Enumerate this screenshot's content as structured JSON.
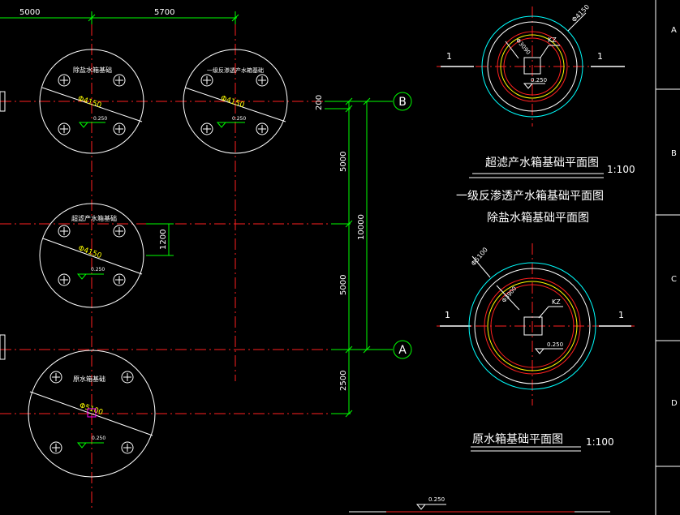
{
  "dims": {
    "top_5000": "5000",
    "top_5700": "5700",
    "v_200": "200",
    "v_5000a": "5000",
    "v_10000": "10000",
    "v_5000b": "5000",
    "v_2500": "2500",
    "v_1200": "1200"
  },
  "axes": {
    "b": "B",
    "a": "A"
  },
  "border": {
    "a": "A",
    "b": "B",
    "c": "C",
    "d": "D"
  },
  "tanks": {
    "t1": {
      "name": "除盐水箱基础",
      "dia": "Φ4150",
      "elev": "0.250"
    },
    "t2": {
      "name": "一级反渗透产水箱基础",
      "dia": "Φ4150",
      "elev": "0.250"
    },
    "t3": {
      "name": "超滤产水箱基础",
      "dia": "Φ4150",
      "elev": "0.250"
    },
    "t4": {
      "name": "原水箱基础",
      "dia": "Φ5100",
      "elev": "0.250"
    }
  },
  "detail_top": {
    "dia_outer": "Φ4150",
    "dia_inner": "Φ3090",
    "kz": "KZ",
    "elev": "0.250",
    "section_l": "1",
    "section_r": "1"
  },
  "detail_bot": {
    "dia_outer": "Φ5100",
    "dia_inner": "Φ3900",
    "kz": "KZ",
    "elev": "0.250",
    "section_l": "1",
    "section_r": "1"
  },
  "titles": {
    "t_uf": "超滤产水箱基础平面图",
    "scale_1": "1:100",
    "t_ro": "一级反渗透产水箱基础平面图",
    "t_demin": "除盐水箱基础平面图",
    "t_raw": "原水箱基础平面图",
    "scale_2": "1:100"
  },
  "bottom": {
    "elev": "0.250"
  }
}
